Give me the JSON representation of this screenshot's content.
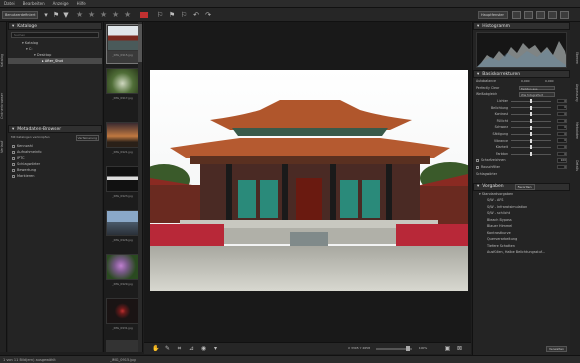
{
  "menubar": {
    "items": [
      "Datei",
      "Bearbeiten",
      "Anzeige",
      "Hilfe"
    ]
  },
  "toolbar": {
    "user_select": "Benutzerdefiniert",
    "view_select": "Hauptfenster",
    "label_color": "#c03030"
  },
  "left_tabs": [
    "Katalog",
    "Ordnerbrowser",
    "Verlauf"
  ],
  "catalogs": {
    "title": "Kataloge",
    "search_placeholder": "Suchen",
    "tree": [
      "Katalog",
      "C:",
      "Desktop",
      "After_Shot"
    ]
  },
  "metadata": {
    "title": "Metadaten-Browser",
    "filter_label": "Mit Katalogen verknüpfen",
    "filter_button": "Verfeinerung",
    "fields": [
      "Kennzahl",
      "Aufnahmeinfo",
      "IPTC",
      "Schlagwörter",
      "Bewertung",
      "Markieren"
    ]
  },
  "filmstrip": [
    {
      "name": "_IMG_0915.jpg",
      "color": "#9ab0c0"
    },
    {
      "name": "_IMG_0917.jpg",
      "color": "#506e38"
    },
    {
      "name": "_IMG_0921.jpg",
      "color": "#a06a3a"
    },
    {
      "name": "_IMG_0923.jpg",
      "color": "#1a1a1a"
    },
    {
      "name": "_IMG_0926.jpg",
      "color": "#6a8aa8"
    },
    {
      "name": "_IMG_0929.jpg",
      "color": "#7a5a8a"
    },
    {
      "name": "_IMG_0931.jpg",
      "color": "#2a2020"
    },
    {
      "name": "_IMG_0935.jpg",
      "color": "#333333"
    }
  ],
  "right_tabs": [
    "Ebenen",
    "Anpassung",
    "Metadaten",
    "Details"
  ],
  "histogram": {
    "title": "Histogramm"
  },
  "basic": {
    "title": "Basiskorrekturen",
    "auto_label": "Autobalance",
    "auto_value1": "0,000",
    "auto_value2": "0,000",
    "perfectly_clear": "Perfectly Clear",
    "perfectly_select": "Farbton aus",
    "weissabgleich": "Weißabgleich",
    "weiss_select": "Wie fotografiert",
    "sliders": [
      {
        "label": "Lichter",
        "value": 0,
        "fraction": 0.5
      },
      {
        "label": "Belichtung",
        "value": 0,
        "fraction": 0.5
      },
      {
        "label": "Kontrast",
        "value": 0,
        "fraction": 0.5
      },
      {
        "label": "Füllicht",
        "value": 0,
        "fraction": 0.5
      },
      {
        "label": "Schwarz",
        "value": 0,
        "fraction": 0.5
      },
      {
        "label": "Sättigung",
        "value": 0,
        "fraction": 0.5
      },
      {
        "label": "Vibrance",
        "value": 0,
        "fraction": 0.5
      },
      {
        "label": "Klarheit",
        "value": 0,
        "fraction": 0.5
      },
      {
        "label": "Farbton",
        "value": 0,
        "fraction": 0.5
      }
    ],
    "sharpen_label": "Scharfzeichnen",
    "sharpen_value": "100",
    "noise_label": "Rauschfilter",
    "noise_value": "0",
    "keywords_label": "Schlagwörter"
  },
  "presets": {
    "title": "Vorgaben",
    "select": "Favoriten",
    "group": "Standardvorgaben",
    "items": [
      "S/W - AFS",
      "S/W - Infrarotsimulation",
      "S/W - schlicht",
      "Bleach Bypass",
      "Blauer Himmel",
      "Kontrastkurve",
      "Querverarbeitung",
      "Tiefere Schatten",
      "Ausfüllen, Halbe Belichtungsstuf..."
    ],
    "button": "Verwalten"
  },
  "bottombar": {
    "coords": "X 3305 Y 2658",
    "zoom": "100%"
  },
  "status": {
    "text": "1 von 11 Bild(ern) ausgewählt",
    "filename": "_IMG_0915.jpg"
  }
}
